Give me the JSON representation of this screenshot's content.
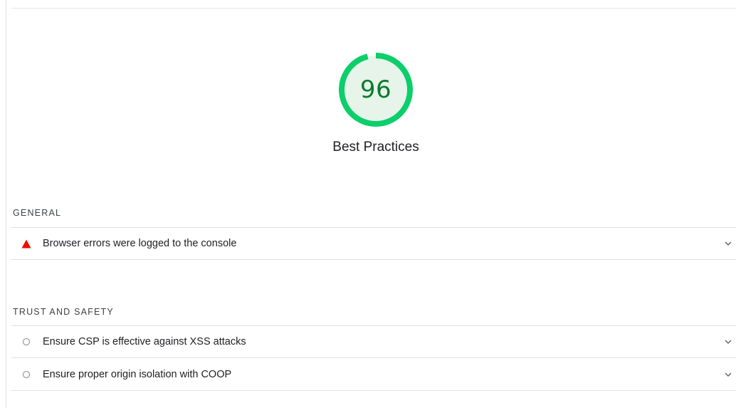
{
  "score": {
    "value": "96",
    "fraction": 0.96,
    "title": "Best Practices",
    "ring_color": "#0cce6b",
    "fill_color": "#e6f4ea",
    "text_color": "#0c7a2e"
  },
  "sections": [
    {
      "heading": "GENERAL",
      "audits": [
        {
          "label": "Browser errors were logged to the console",
          "status": "fail",
          "icon": "red-triangle-icon",
          "status_color": "#eb0f00"
        }
      ]
    },
    {
      "heading": "TRUST AND SAFETY",
      "audits": [
        {
          "label": "Ensure CSP is effective against XSS attacks",
          "status": "informative",
          "icon": "hollow-circle-icon",
          "status_color": "#9aa0a6"
        },
        {
          "label": "Ensure proper origin isolation with COOP",
          "status": "informative",
          "icon": "hollow-circle-icon",
          "status_color": "#9aa0a6"
        }
      ]
    }
  ]
}
